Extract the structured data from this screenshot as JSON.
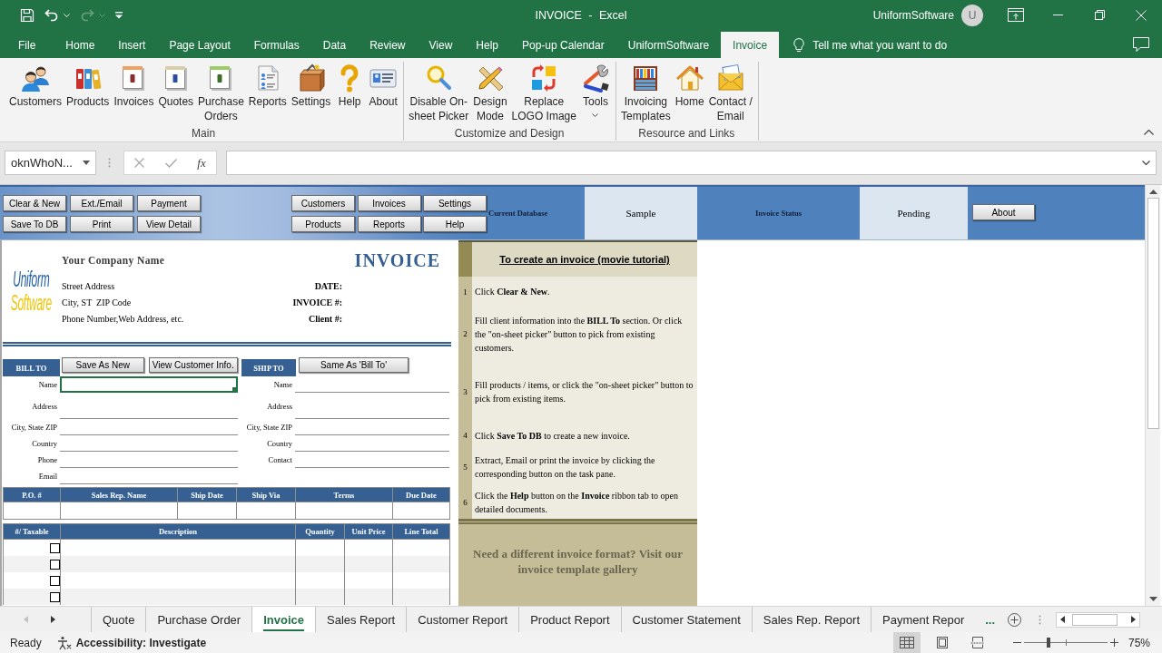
{
  "title_bar": {
    "quick_access": [
      {
        "kind": "save",
        "disabled": false
      },
      {
        "kind": "undo",
        "disabled": false
      },
      {
        "kind": "redo",
        "disabled": true
      },
      {
        "kind": "customize",
        "disabled": false
      }
    ],
    "title": "INVOICE - Excel",
    "user": "UniformSoftware",
    "avatar_initial": "U"
  },
  "ribbon": {
    "tabs": [
      {
        "label": "File",
        "selected": false
      },
      {
        "label": "Home",
        "selected": false
      },
      {
        "label": "Insert",
        "selected": false
      },
      {
        "label": "Page Layout",
        "selected": false
      },
      {
        "label": "Formulas",
        "selected": false
      },
      {
        "label": "Data",
        "selected": false
      },
      {
        "label": "Review",
        "selected": false
      },
      {
        "label": "View",
        "selected": false
      },
      {
        "label": "Help",
        "selected": false
      },
      {
        "label": "Pop-up Calendar",
        "selected": false
      },
      {
        "label": "UniformSoftware",
        "selected": false
      },
      {
        "label": "Invoice",
        "selected": true
      }
    ],
    "tell_me": "Tell me what you want to do",
    "groups": [
      {
        "label": "Main",
        "buttons": [
          {
            "kind": "customers",
            "label": "Customers",
            "dropdown": false
          },
          {
            "kind": "products",
            "label": "Products",
            "dropdown": false
          },
          {
            "kind": "invoices",
            "label": "Invoices",
            "dropdown": false
          },
          {
            "kind": "quotes",
            "label": "Quotes",
            "dropdown": false
          },
          {
            "kind": "purchase_orders",
            "label": "Purchase\nOrders",
            "dropdown": false
          },
          {
            "kind": "reports",
            "label": "Reports",
            "dropdown": false
          },
          {
            "kind": "settings",
            "label": "Settings",
            "dropdown": false
          },
          {
            "kind": "help",
            "label": "Help",
            "dropdown": false
          },
          {
            "kind": "about",
            "label": "About",
            "dropdown": false
          }
        ]
      },
      {
        "label": "Customize and Design",
        "buttons": [
          {
            "kind": "picker",
            "label": "Disable On-\nsheet Picker",
            "dropdown": false
          },
          {
            "kind": "design",
            "label": "Design\nMode",
            "dropdown": false
          },
          {
            "kind": "logo",
            "label": "Replace\nLOGO Image",
            "dropdown": false
          },
          {
            "kind": "tools",
            "label": "Tools",
            "dropdown": true
          }
        ]
      },
      {
        "label": "Resource and Links",
        "buttons": [
          {
            "kind": "templates",
            "label": "Invoicing\nTemplates",
            "dropdown": false
          },
          {
            "kind": "home",
            "label": "Home",
            "dropdown": false
          },
          {
            "kind": "contact",
            "label": "Contact /\nEmail",
            "dropdown": false
          }
        ]
      }
    ]
  },
  "formula_bar": {
    "name_box": "oknWhoN...",
    "function_button": "fx"
  },
  "task_pane": {
    "action_buttons": [
      [
        "Clear & New",
        "Ext./Email",
        "Payment"
      ],
      [
        "Save To DB",
        "Print",
        "View Detail"
      ]
    ],
    "nav_buttons": [
      [
        "Customers",
        "Invoices",
        "Settings"
      ],
      [
        "Products",
        "Reports",
        "Help"
      ]
    ],
    "current_database": {
      "label": "Current Database",
      "value": "Sample"
    },
    "invoice_status": {
      "label": "Invoice Status",
      "value": "Pending"
    },
    "about_button": "About"
  },
  "invoice": {
    "logo": [
      "Uniform",
      "Software"
    ],
    "company_name": "Your Company Name",
    "title": "INVOICE",
    "company_lines": [
      "Street Address",
      "City, ST  ZIP Code",
      "Phone Number,Web Address, etc."
    ],
    "meta_labels": [
      "DATE:",
      "INVOICE #:",
      "Client #:"
    ],
    "bill_to": {
      "heading": "BILL TO",
      "buttons": [
        "Save As New",
        "View Customer Info."
      ],
      "fields": [
        {
          "label": "Name",
          "selected": true
        },
        {
          "label": "Address",
          "selected": false
        },
        {
          "label": "City, State ZIP",
          "selected": false
        },
        {
          "label": "Country",
          "selected": false
        },
        {
          "label": "Phone",
          "selected": false
        },
        {
          "label": "Email",
          "selected": false
        }
      ]
    },
    "ship_to": {
      "heading": "SHIP TO",
      "buttons": [
        "Same As 'Bill To'"
      ],
      "fields": [
        {
          "label": "Name",
          "selected": false
        },
        {
          "label": "Address",
          "selected": false
        },
        {
          "label": "City, State ZIP",
          "selected": false
        },
        {
          "label": "Country",
          "selected": false
        },
        {
          "label": "Contact",
          "selected": false
        }
      ]
    },
    "order_table": {
      "columns": [
        "P.O. #",
        "Sales Rep. Name",
        "Ship Date",
        "Ship Via",
        "Terms",
        "Due Date"
      ]
    },
    "items_table": {
      "columns": [
        "#/ Taxable",
        "Description",
        "Quantity",
        "Unit Price",
        "Line Total"
      ],
      "rows": [
        {
          "taxable": false
        },
        {
          "taxable": false
        },
        {
          "taxable": false
        },
        {
          "taxable": false
        }
      ]
    }
  },
  "tutorial": {
    "title": "To create an invoice (movie tutorial)",
    "steps": [
      {
        "number": "1",
        "text": "Click **Clear & New**."
      },
      {
        "number": "2",
        "text": "Fill client information into the **BILL To** section. Or click the \"on-sheet picker\" button to pick from existing customers."
      },
      {
        "number": "3",
        "text": "Fill products / items, or click the \"on-sheet picker\" button to pick from existing items."
      },
      {
        "number": "4",
        "text": "Click **Save To DB** to create a new invoice."
      },
      {
        "number": "5",
        "text": "Extract, Email or print the invoice by clicking the corresponding button on the task pane."
      },
      {
        "number": "6",
        "text": "Click the **Help** button on the **Invoice** ribbon tab to open detailed documents."
      }
    ],
    "gallery_link": "Need a different invoice format? Visit our invoice template gallery"
  },
  "sheet_tabs": [
    {
      "label": "Quote",
      "selected": false
    },
    {
      "label": "Purchase Order",
      "selected": false
    },
    {
      "label": "Invoice",
      "selected": true
    },
    {
      "label": "Sales Report",
      "selected": false
    },
    {
      "label": "Customer Report",
      "selected": false
    },
    {
      "label": "Product Report",
      "selected": false
    },
    {
      "label": "Customer Statement",
      "selected": false
    },
    {
      "label": "Sales Rep. Report",
      "selected": false
    },
    {
      "label": "Payment Repor",
      "selected": false
    }
  ],
  "more_sheets": "...",
  "status_bar": {
    "status": "Ready",
    "accessibility": "Accessibility: Investigate",
    "views": [
      {
        "kind": "normal",
        "selected": true
      },
      {
        "kind": "page_layout",
        "selected": false
      },
      {
        "kind": "page_break",
        "selected": false
      }
    ],
    "zoom": {
      "level": 0.29,
      "reading": "75%"
    }
  }
}
